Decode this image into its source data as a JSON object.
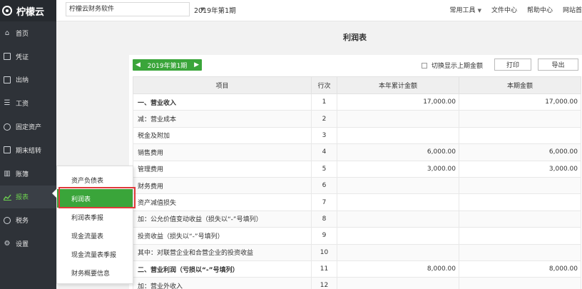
{
  "brand": {
    "name": "柠檬云"
  },
  "sidebar": {
    "items": [
      {
        "label": "首页",
        "icon": "home-icon"
      },
      {
        "label": "凭证",
        "icon": "voucher-icon"
      },
      {
        "label": "出纳",
        "icon": "cashier-icon"
      },
      {
        "label": "工资",
        "icon": "salary-icon"
      },
      {
        "label": "固定资产",
        "icon": "asset-icon"
      },
      {
        "label": "期末结转",
        "icon": "period-close-icon"
      },
      {
        "label": "账簿",
        "icon": "ledger-icon"
      },
      {
        "label": "报表",
        "icon": "report-chart-icon",
        "active": true
      },
      {
        "label": "税务",
        "icon": "tax-icon"
      },
      {
        "label": "设置",
        "icon": "settings-icon"
      }
    ]
  },
  "topbar": {
    "company": "柠檬云财务软件",
    "period": "2019年第1期",
    "links": [
      "常用工具",
      "文件中心",
      "帮助中心",
      "网站首"
    ]
  },
  "page": {
    "title": "利润表"
  },
  "toolbar": {
    "period_label": "2019年第1期",
    "toggle_label": "切换显示上期金额",
    "print_label": "打印",
    "export_label": "导出"
  },
  "table": {
    "headers": [
      "项目",
      "行次",
      "本年累计金额",
      "本期金额"
    ],
    "rows": [
      {
        "item": "一、营业收入",
        "line": "1",
        "ytd": "17,000.00",
        "current": "17,000.00",
        "bold": true
      },
      {
        "item": "减：营业成本",
        "line": "2",
        "ytd": "",
        "current": ""
      },
      {
        "item": "税金及附加",
        "line": "3",
        "ytd": "",
        "current": ""
      },
      {
        "item": "销售费用",
        "line": "4",
        "ytd": "6,000.00",
        "current": "6,000.00"
      },
      {
        "item": "管理费用",
        "line": "5",
        "ytd": "3,000.00",
        "current": "3,000.00"
      },
      {
        "item": "财务费用",
        "line": "6",
        "ytd": "",
        "current": ""
      },
      {
        "item": "资产减值损失",
        "line": "7",
        "ytd": "",
        "current": ""
      },
      {
        "item": "加：公允价值变动收益（损失以“-”号填列）",
        "line": "8",
        "ytd": "",
        "current": ""
      },
      {
        "item": "投资收益（损失以“-”号填列）",
        "line": "9",
        "ytd": "",
        "current": ""
      },
      {
        "item": "其中：对联营企业和合营企业的投资收益",
        "line": "10",
        "ytd": "",
        "current": ""
      },
      {
        "item": "二、营业利润（亏损以“-”号填列）",
        "line": "11",
        "ytd": "8,000.00",
        "current": "8,000.00",
        "bold": true
      },
      {
        "item": "加：营业外收入",
        "line": "12",
        "ytd": "",
        "current": ""
      }
    ]
  },
  "report_menu": {
    "items": [
      "资产负债表",
      "利润表",
      "利润表季报",
      "现金流量表",
      "现金流量表季报",
      "财务概要信息"
    ],
    "highlighted_index": 1
  },
  "colors": {
    "accent_green": "#3aa53a",
    "sidebar_bg": "#2e3238",
    "highlight_red": "#e03b3b"
  }
}
